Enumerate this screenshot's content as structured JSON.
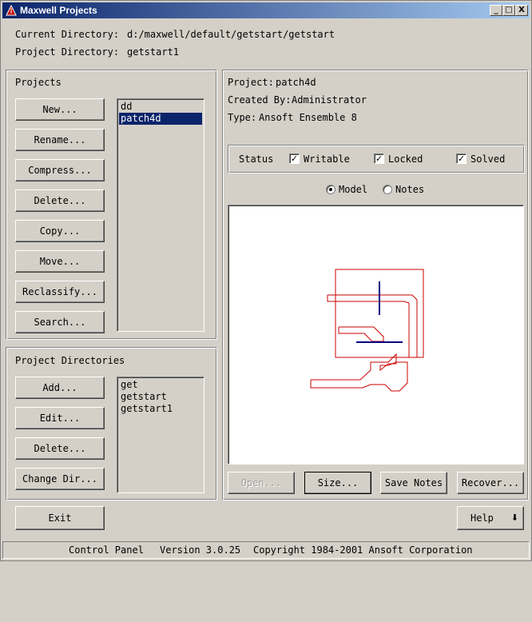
{
  "window": {
    "title": "Maxwell Projects",
    "minimize": "_",
    "maximize": "□",
    "close": "X"
  },
  "header": {
    "current_dir_label": "Current Directory:",
    "current_dir_value": "d:/maxwell/default/getstart/getstart",
    "project_dir_label": "Project Directory:",
    "project_dir_value": "getstart1"
  },
  "projects": {
    "heading": "Projects",
    "buttons": {
      "new": "New...",
      "rename": "Rename...",
      "compress": "Compress...",
      "delete": "Delete...",
      "copy": "Copy...",
      "move": "Move...",
      "reclassify": "Reclassify...",
      "search": "Search..."
    },
    "list": [
      "dd",
      "patch4d"
    ],
    "selected": "patch4d"
  },
  "project_dirs": {
    "heading": "Project Directories",
    "buttons": {
      "add": "Add...",
      "edit": "Edit...",
      "delete": "Delete...",
      "change_dir": "Change Dir..."
    },
    "list": [
      "get",
      "getstart",
      "getstart1"
    ]
  },
  "info": {
    "project_label": "Project:",
    "project_value": "patch4d",
    "created_label": "Created By:",
    "created_value": "Administrator",
    "type_label": "Type:",
    "type_value": "Ansoft Ensemble 8"
  },
  "status": {
    "label": "Status",
    "writable": "Writable",
    "locked": "Locked",
    "solved": "Solved",
    "check_mark": "✓"
  },
  "view": {
    "model": "Model",
    "notes": "Notes",
    "selected": "Model"
  },
  "actions": {
    "open": "Open...",
    "size": "Size...",
    "save_notes": "Save Notes",
    "recover": "Recover..."
  },
  "bottom": {
    "exit": "Exit",
    "help": "Help",
    "help_arrow": "⬇"
  },
  "statusbar": {
    "component": "Control Panel",
    "version": "Version 3.0.25",
    "copyright": "Copyright 1984-2001 Ansoft Corporation"
  },
  "colors": {
    "geometry_outline": "#cc0000",
    "feed_lines": "#000080"
  }
}
